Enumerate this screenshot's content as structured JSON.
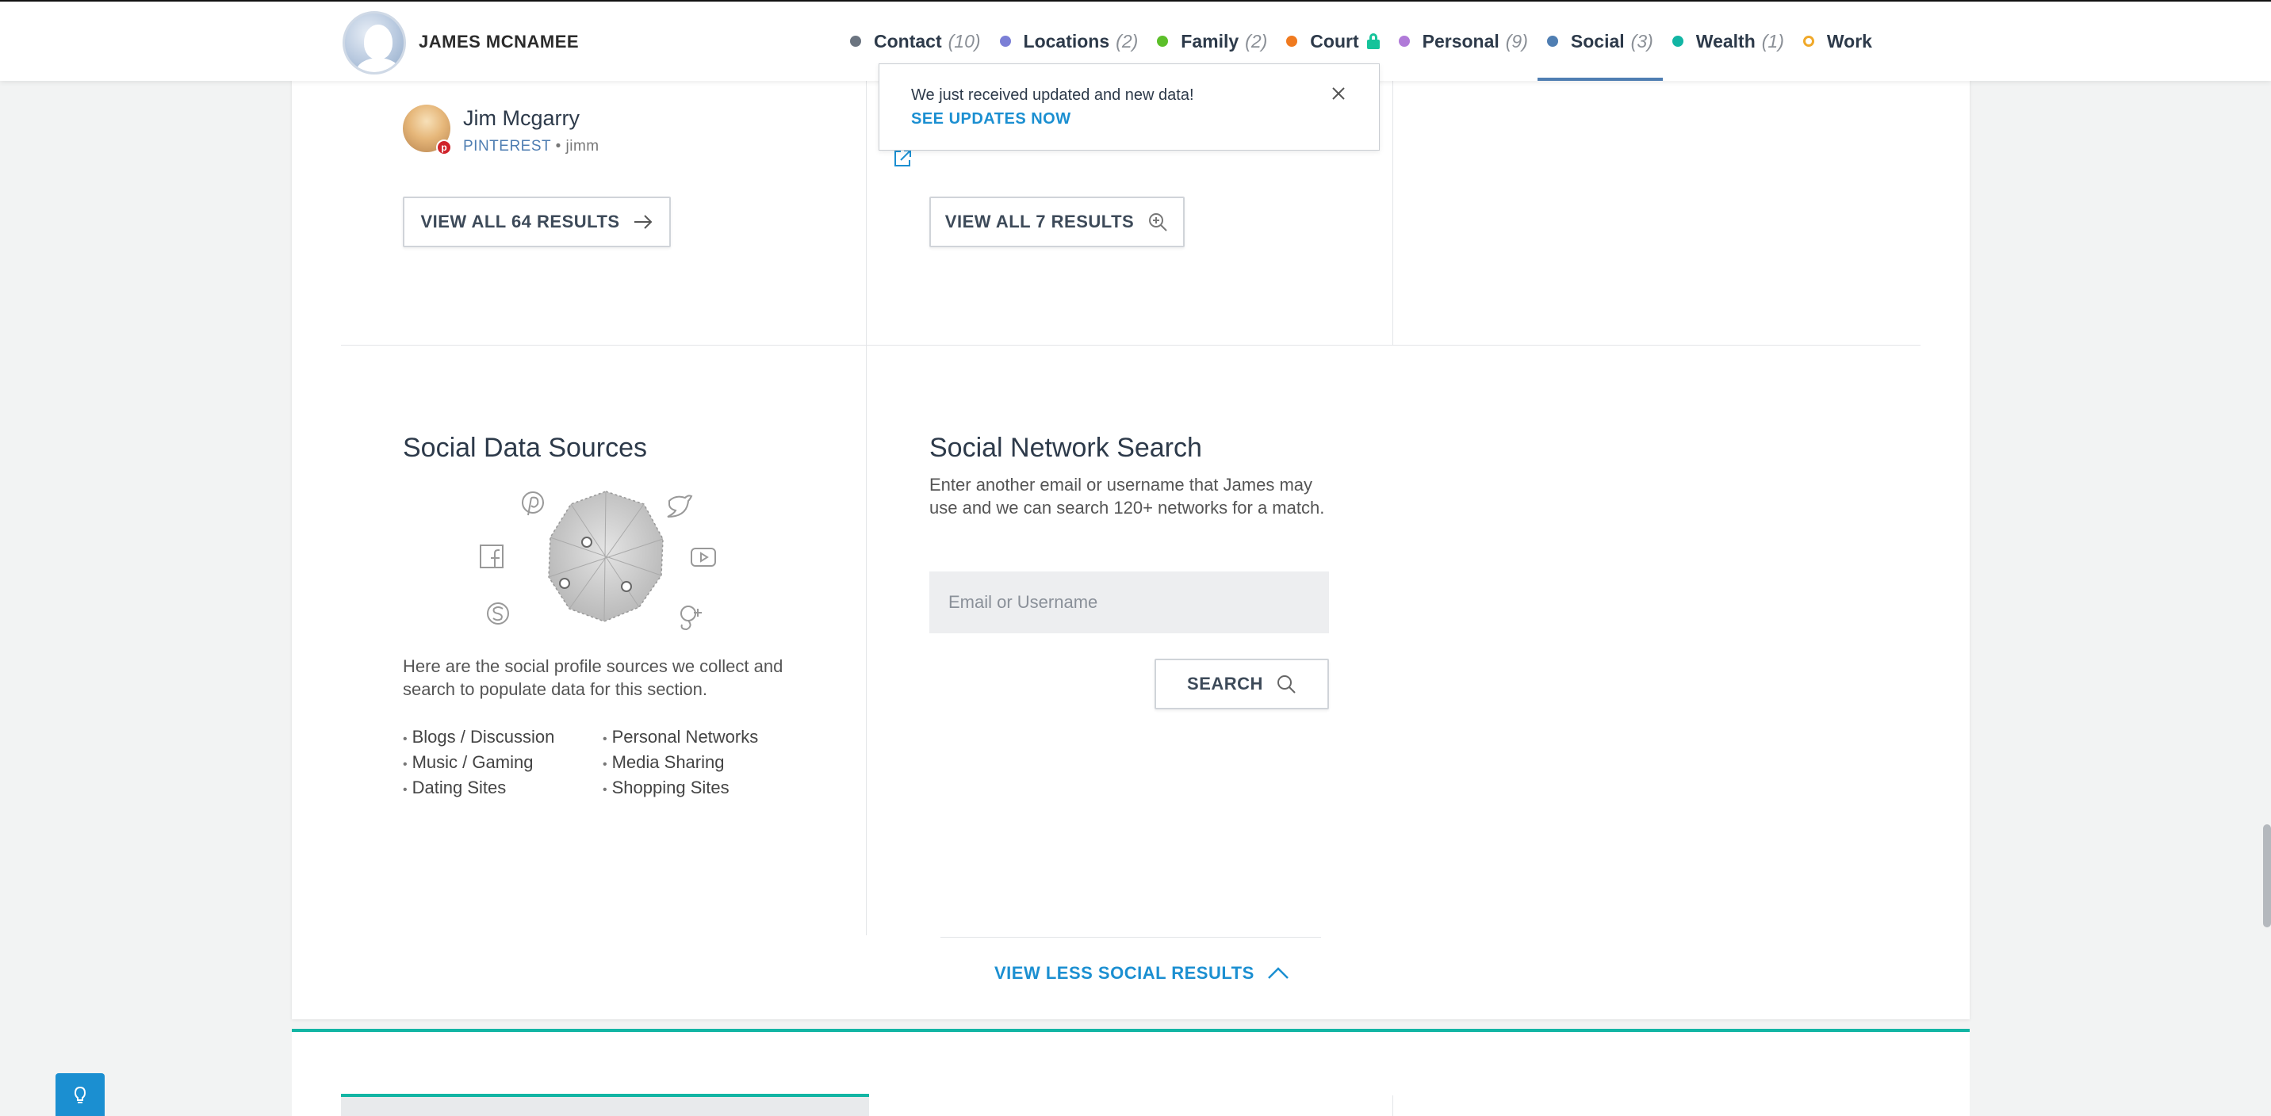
{
  "header": {
    "person_name": "JAMES MCNAMEE",
    "tabs": [
      {
        "label": "Contact",
        "count": "(10)",
        "color": "#6b7480"
      },
      {
        "label": "Locations",
        "count": "(2)",
        "color": "#7b7fd6"
      },
      {
        "label": "Family",
        "count": "(2)",
        "color": "#5cbf2a"
      },
      {
        "label": "Court",
        "count": "",
        "color": "#f07a1f",
        "locked": true
      },
      {
        "label": "Personal",
        "count": "(9)",
        "color": "#b07ad8"
      },
      {
        "label": "Social",
        "count": "(3)",
        "color": "#4f7eb2",
        "active": true
      },
      {
        "label": "Wealth",
        "count": "(1)",
        "color": "#12b5a4"
      },
      {
        "label": "Work",
        "count": "",
        "color": "#f0a92a",
        "ring": true
      }
    ]
  },
  "notification": {
    "message": "We just received updated and new data!",
    "link_label": "SEE UPDATES NOW"
  },
  "result": {
    "name": "Jim Mcgarry",
    "source": "PINTEREST",
    "separator": "•",
    "username": "jimm",
    "badge_letter": "p"
  },
  "buttons": {
    "view_all_left": "VIEW ALL 64 RESULTS",
    "view_all_middle": "VIEW ALL 7 RESULTS",
    "search": "SEARCH",
    "view_less": "VIEW LESS SOCIAL RESULTS"
  },
  "data_sources": {
    "title": "Social Data Sources",
    "description": "Here are the social profile sources we collect and search to populate data for this section.",
    "list_left": [
      "Blogs / Discussion",
      "Music / Gaming",
      "Dating Sites"
    ],
    "list_right": [
      "Personal Networks",
      "Media Sharing",
      "Shopping Sites"
    ]
  },
  "network_search": {
    "title": "Social Network Search",
    "description": "Enter another email or username that James may use and we can search 120+ networks for a match.",
    "input_placeholder": "Email or Username",
    "input_value": ""
  },
  "colors": {
    "accent_blue": "#1b8fd1",
    "teal": "#12b5a4",
    "pinterest_red": "#d0232b"
  }
}
